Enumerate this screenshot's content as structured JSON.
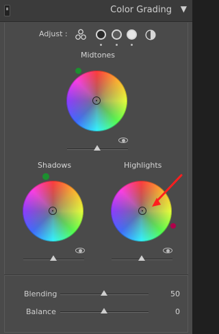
{
  "header": {
    "title": "Color Grading",
    "collapse_glyph": "▼",
    "toggle_icon": "panel-toggle-icon"
  },
  "adjust": {
    "label": "Adjust :",
    "modes": [
      {
        "name": "three-way",
        "icon": "three-wheels-icon",
        "selected": true
      },
      {
        "name": "shadows",
        "icon": "shadows-wheel-icon",
        "selected": false
      },
      {
        "name": "midtones",
        "icon": "midtones-wheel-icon",
        "selected": false
      },
      {
        "name": "highlights",
        "icon": "highlights-wheel-icon",
        "selected": false
      },
      {
        "name": "global",
        "icon": "global-icon",
        "selected": false
      }
    ]
  },
  "wheels": {
    "midtones": {
      "label": "Midtones",
      "eye_icon": "eye-icon",
      "marker_color": "#1c8f2f"
    },
    "shadows": {
      "label": "Shadows",
      "eye_icon": "eye-icon",
      "marker_color": "#1c8f2f"
    },
    "highlights": {
      "label": "Highlights",
      "eye_icon": "eye-icon",
      "marker_color": "#b0004a"
    }
  },
  "controls": {
    "blending": {
      "label": "Blending",
      "value": "50"
    },
    "balance": {
      "label": "Balance",
      "value": "0"
    }
  },
  "colors": {
    "panel_bg": "#4a4a4a",
    "header_bg": "#3b3b3b",
    "text": "#cfcfcf",
    "annotation_red": "#ff1e1e"
  }
}
